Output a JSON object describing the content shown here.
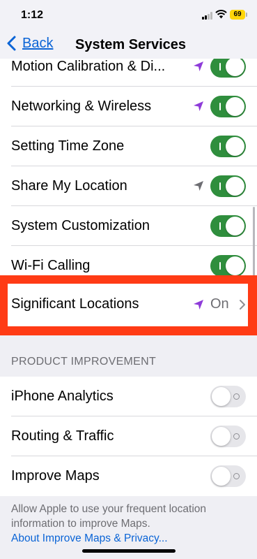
{
  "status_bar": {
    "time": "1:12",
    "battery": "69"
  },
  "nav": {
    "back_label": "Back",
    "title": "System Services"
  },
  "rows_top": [
    {
      "label": "Motion Calibration & Di...",
      "arrow": "purple-arrow-icon",
      "toggle": "on"
    },
    {
      "label": "Networking & Wireless",
      "arrow": "purple-arrow-icon",
      "toggle": "on"
    },
    {
      "label": "Setting Time Zone",
      "arrow": "",
      "toggle": "on"
    },
    {
      "label": "Share My Location",
      "arrow": "gray-arrow-icon",
      "toggle": "on"
    },
    {
      "label": "System Customization",
      "arrow": "",
      "toggle": "on"
    },
    {
      "label": "Wi-Fi Calling",
      "arrow": "",
      "toggle": "on"
    }
  ],
  "significant_locations": {
    "label": "Significant Locations",
    "value": "On"
  },
  "section": {
    "header": "PRODUCT IMPROVEMENT"
  },
  "rows_bottom": [
    {
      "label": "iPhone Analytics",
      "toggle": "off"
    },
    {
      "label": "Routing & Traffic",
      "toggle": "off"
    },
    {
      "label": "Improve Maps",
      "toggle": "off"
    }
  ],
  "footer": {
    "text": "Allow Apple to use your frequent location information to improve Maps.",
    "link": "About Improve Maps & Privacy..."
  },
  "colors": {
    "accent": "#0a64d6",
    "toggle_on": "#2f8e3d",
    "highlight": "#ff3b15",
    "location_purple": "#8e3bd9"
  }
}
